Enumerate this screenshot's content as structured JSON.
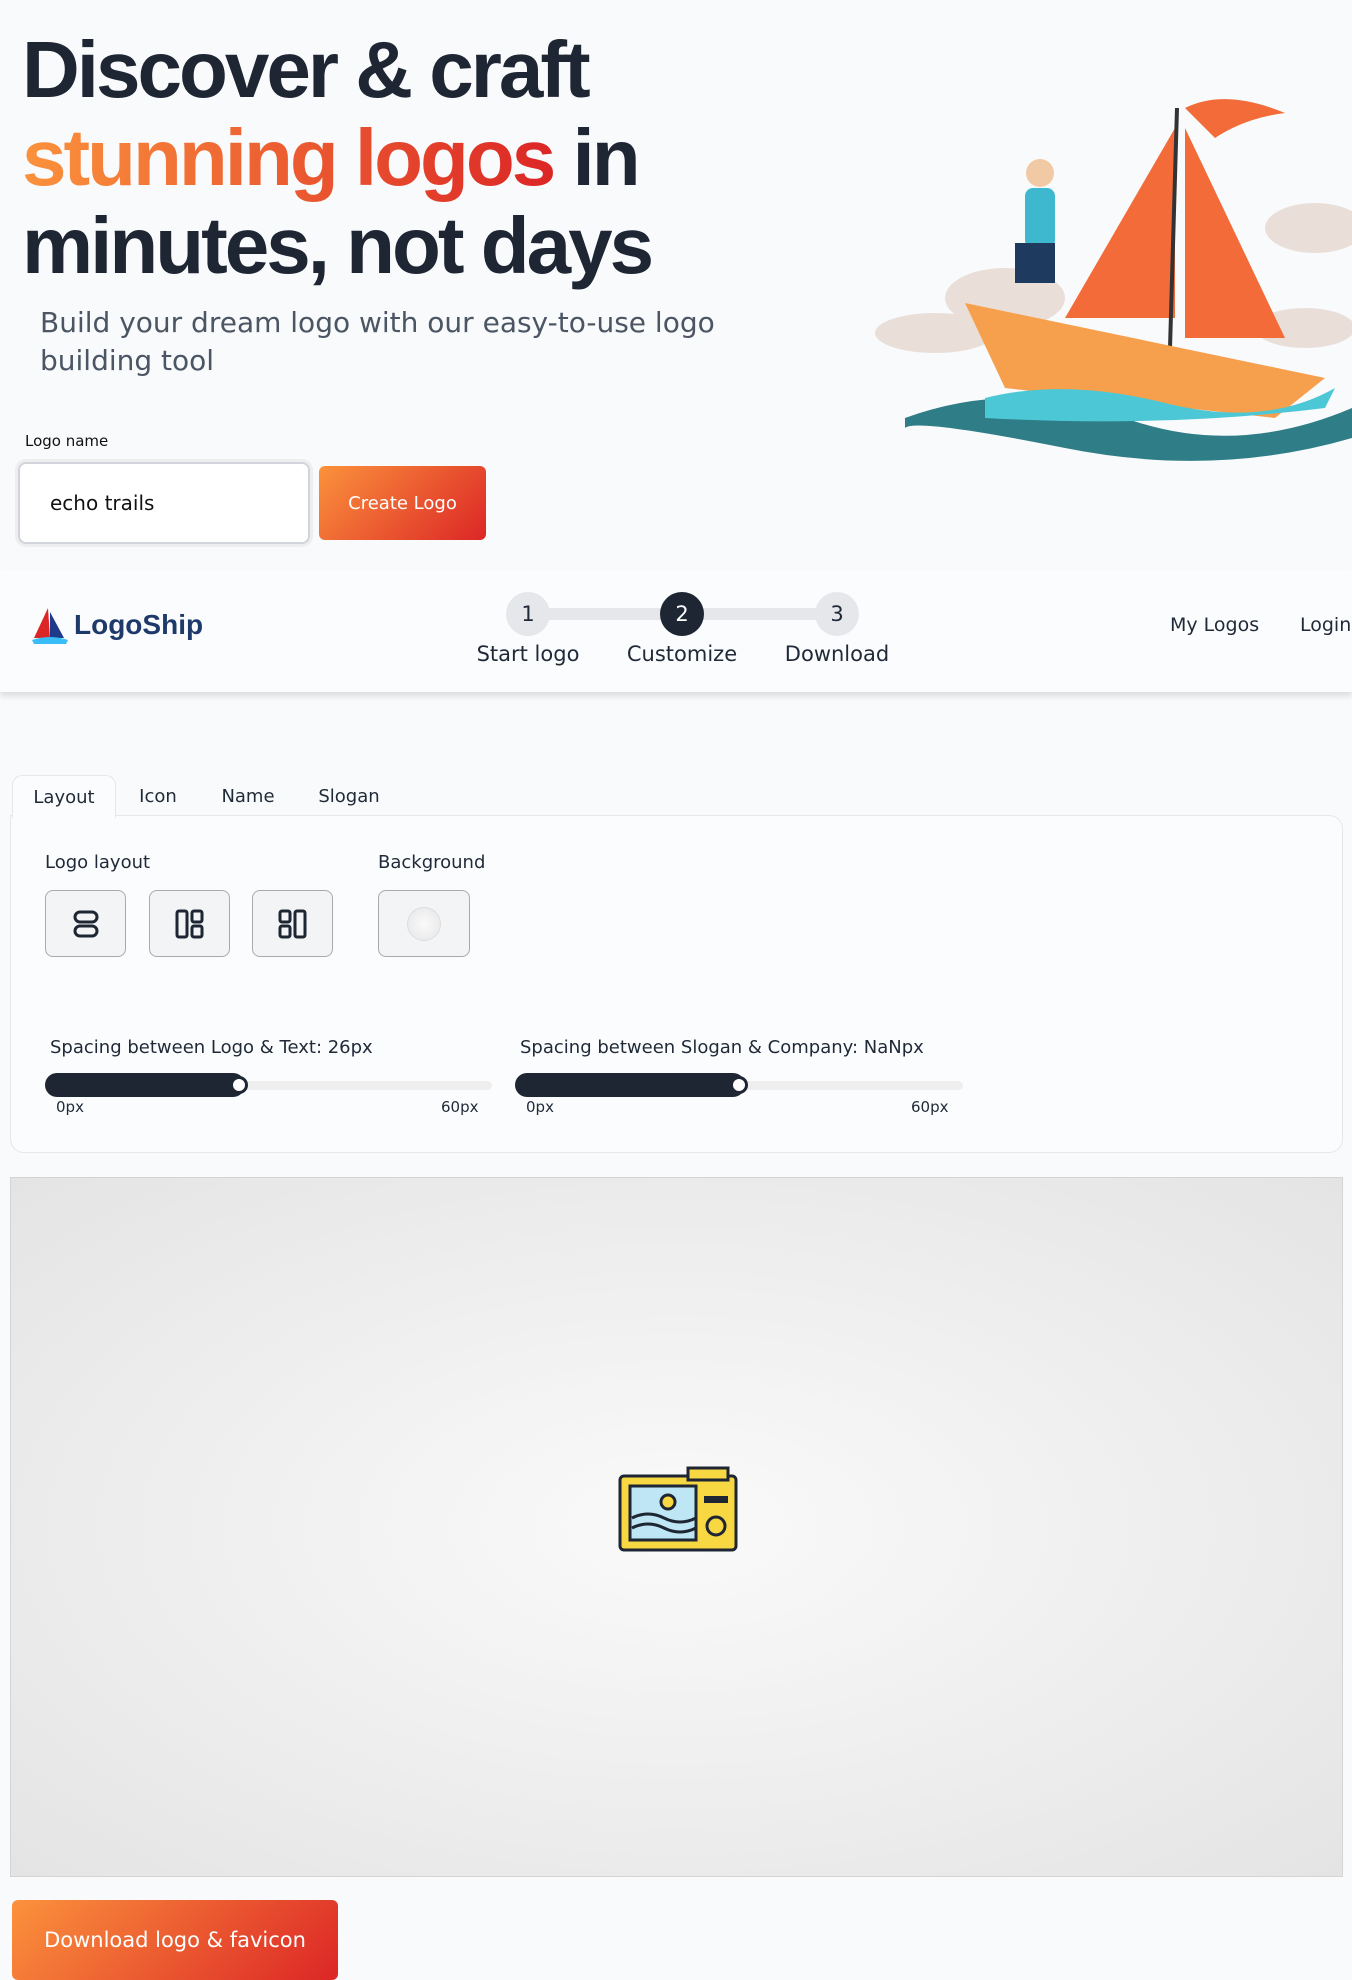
{
  "hero": {
    "line1": "Discover & craft",
    "line2_highlight": "stunning logos",
    "line2_rest": " in",
    "line3": "minutes, not days",
    "subtitle": "Build your dream logo with our easy-to-use logo building tool",
    "input_label": "Logo name",
    "input_value": "echo trails",
    "create_button": "Create Logo"
  },
  "header": {
    "brand": "LogoShip",
    "steps": [
      {
        "num": "1",
        "label": "Start logo"
      },
      {
        "num": "2",
        "label": "Customize",
        "active": true
      },
      {
        "num": "3",
        "label": "Download"
      }
    ],
    "nav": [
      "My Logos",
      "Login"
    ]
  },
  "tabs": [
    "Layout",
    "Icon",
    "Name",
    "Slogan"
  ],
  "layout_panel": {
    "logo_layout_label": "Logo layout",
    "background_label": "Background",
    "slider1": {
      "label": "Spacing between Logo & Text: 26px",
      "value": 26,
      "min": "0px",
      "max": "60px"
    },
    "slider2": {
      "label": "Spacing between Slogan & Company: NaNpx",
      "value": 30,
      "min": "0px",
      "max": "60px"
    }
  },
  "download_button": "Download logo & favicon",
  "colors": {
    "accent_start": "#fb923c",
    "accent_end": "#dc2626",
    "dark": "#1e2533"
  }
}
